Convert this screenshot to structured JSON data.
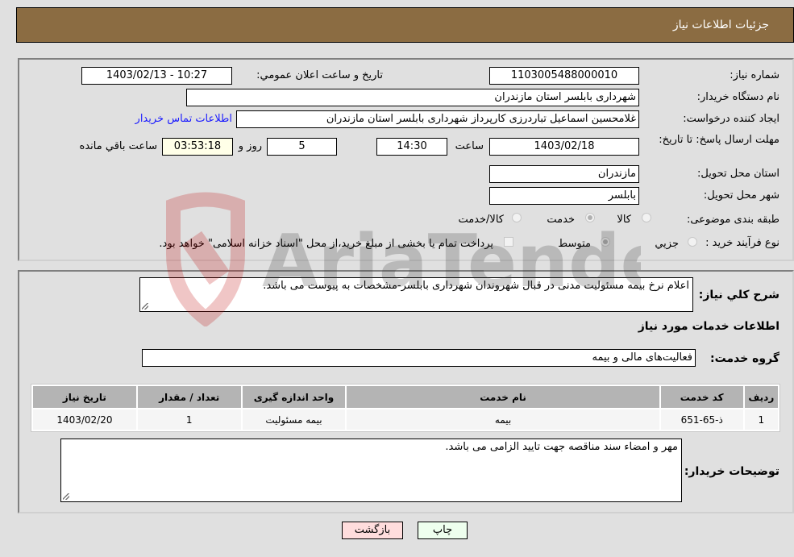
{
  "header": {
    "title": "جزئیات اطلاعات نیاز"
  },
  "form": {
    "need_number_label": "شماره نیاز:",
    "need_number": "1103005488000010",
    "announce_label": "تاریخ و ساعت اعلان عمومي:",
    "announce_value": "1403/02/13 - 10:27",
    "buyer_org_label": "نام دستگاه خریدار:",
    "buyer_org": "شهرداری بابلسر استان مازندران",
    "creator_label": "ایجاد کننده درخواست:",
    "creator": "غلامحسین اسماعیل تباردرزی کارپرداز شهرداری بابلسر استان مازندران",
    "contact_link": "اطلاعات تماس خریدار",
    "deadline_label": "مهلت ارسال پاسخ: تا تاریخ:",
    "deadline_date": "1403/02/18",
    "time_label": "ساعت",
    "deadline_time": "14:30",
    "days_value": "5",
    "days_label": "روز و",
    "remaining_time": "03:53:18",
    "remaining_label": "ساعت باقي مانده",
    "province_label": "استان محل تحویل:",
    "province": "مازندران",
    "city_label": "شهر محل تحویل:",
    "city": "بابلسر",
    "category_label": "طبقه بندی موضوعی:",
    "category_options": [
      {
        "label": "کالا",
        "checked": false
      },
      {
        "label": "خدمت",
        "checked": true
      },
      {
        "label": "کالا/خدمت",
        "checked": false
      }
    ],
    "purchase_type_label": "نوع فرآیند خرید :",
    "purchase_type_options": [
      {
        "label": "جزيي",
        "checked": false
      },
      {
        "label": "متوسط",
        "checked": true
      }
    ],
    "treasury_note": "پرداخت تمام یا بخشی از مبلغ خرید،از محل \"اسناد خزانه اسلامی\" خواهد بود.",
    "treasury_checked": false
  },
  "details": {
    "description_label": "شرح كلي نياز:",
    "description": "اعلام نرخ بیمه مسئولیت مدنی در قبال شهروندان شهرداری بابلسر-مشخصات به پیوست می باشد.",
    "services_heading": "اطلاعات خدمات مورد نیاز",
    "service_group_label": "گروه خدمت:",
    "service_group": "فعالیت‌های مالی و بیمه",
    "table": {
      "headers": [
        "ردیف",
        "کد خدمت",
        "نام خدمت",
        "واحد اندازه گیری",
        "تعداد / مقدار",
        "تاریخ نیاز"
      ],
      "rows": [
        [
          "1",
          "ذ-65-651",
          "بیمه",
          "بیمه مسئولیت",
          "1",
          "1403/02/20"
        ]
      ]
    },
    "buyer_notes_label": "توضیحات خریدار:",
    "buyer_notes": "مهر و امضاء سند مناقصه جهت تایید الزامی می باشد."
  },
  "buttons": {
    "print": "چاپ",
    "back": "بازگشت"
  },
  "watermark": {
    "text": "AriaTender.neT"
  }
}
